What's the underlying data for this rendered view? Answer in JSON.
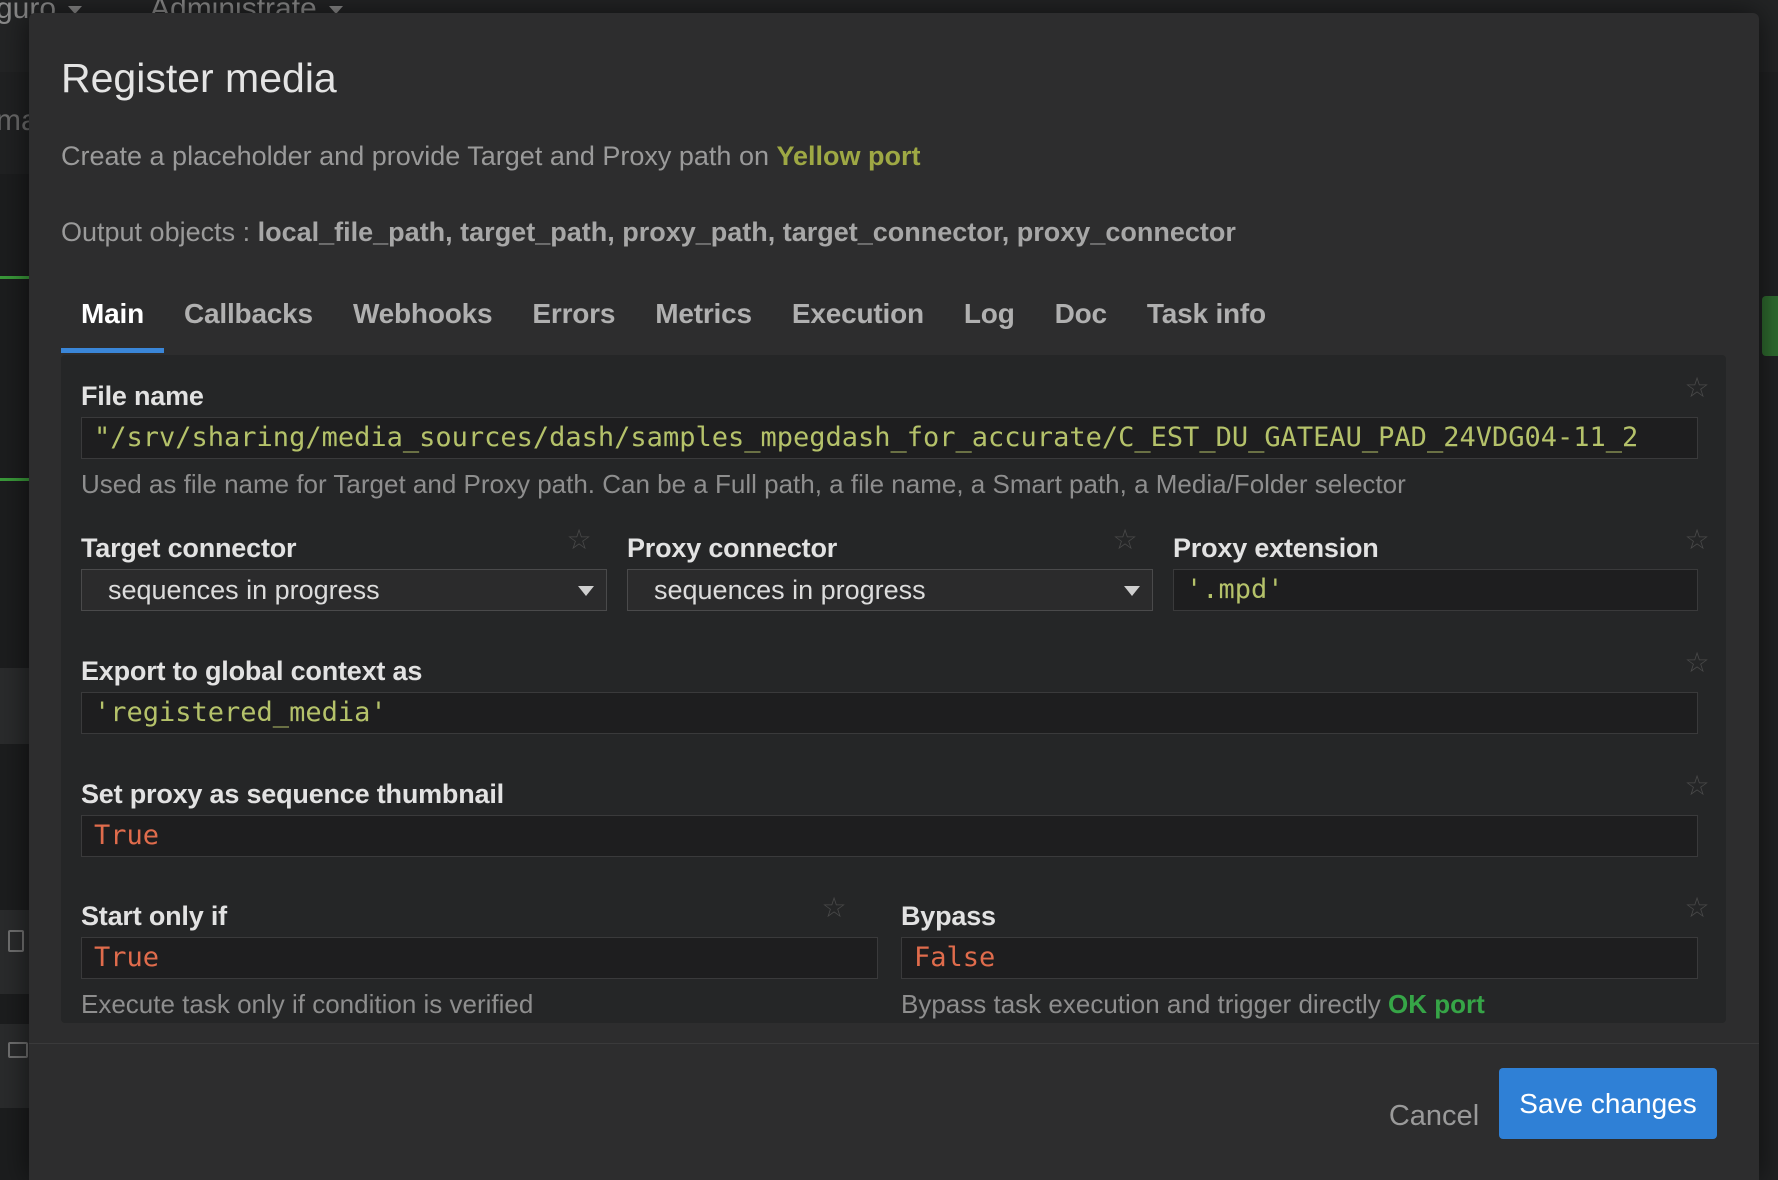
{
  "background": {
    "menu_1": "guro",
    "menu_2": "Administrate",
    "side_fragment": "ma"
  },
  "modal": {
    "title": "Register media",
    "description_prefix": "Create a placeholder and provide Target and Proxy path on ",
    "description_accent": "Yellow port",
    "outputs_label": "Output objects : ",
    "outputs_values": "local_file_path, target_path, proxy_path, target_connector, proxy_connector"
  },
  "tabs": [
    {
      "label": "Main",
      "active": true
    },
    {
      "label": "Callbacks"
    },
    {
      "label": "Webhooks"
    },
    {
      "label": "Errors"
    },
    {
      "label": "Metrics"
    },
    {
      "label": "Execution"
    },
    {
      "label": "Log"
    },
    {
      "label": "Doc"
    },
    {
      "label": "Task info"
    }
  ],
  "fields": {
    "file_name": {
      "label": "File name",
      "value": "\"/srv/sharing/media_sources/dash/samples_mpegdash_for_accurate/C_EST_DU_GATEAU_PAD_24VDG04-11_2",
      "help": "Used as file name for Target and Proxy path. Can be a Full path, a file name, a Smart path, a Media/Folder selector"
    },
    "target_connector": {
      "label": "Target connector",
      "value": "sequences in progress"
    },
    "proxy_connector": {
      "label": "Proxy connector",
      "value": "sequences in progress"
    },
    "proxy_extension": {
      "label": "Proxy extension",
      "value": "'.mpd'"
    },
    "export_context": {
      "label": "Export to global context as",
      "value": "'registered_media'"
    },
    "proxy_thumbnail": {
      "label": "Set proxy as sequence thumbnail",
      "value": "True"
    },
    "start_only_if": {
      "label": "Start only if",
      "value": "True",
      "help": "Execute task only if condition is verified"
    },
    "bypass": {
      "label": "Bypass",
      "value": "False",
      "help_prefix": "Bypass task execution and trigger directly ",
      "help_accent": "OK port"
    }
  },
  "footer": {
    "cancel_label": "Cancel",
    "save_label": "Save changes"
  },
  "colors": {
    "accent_blue": "#2f80d6",
    "yellow_port": "#9ea844",
    "bool_value": "#e06c4c",
    "string_value": "#b5c26a"
  }
}
